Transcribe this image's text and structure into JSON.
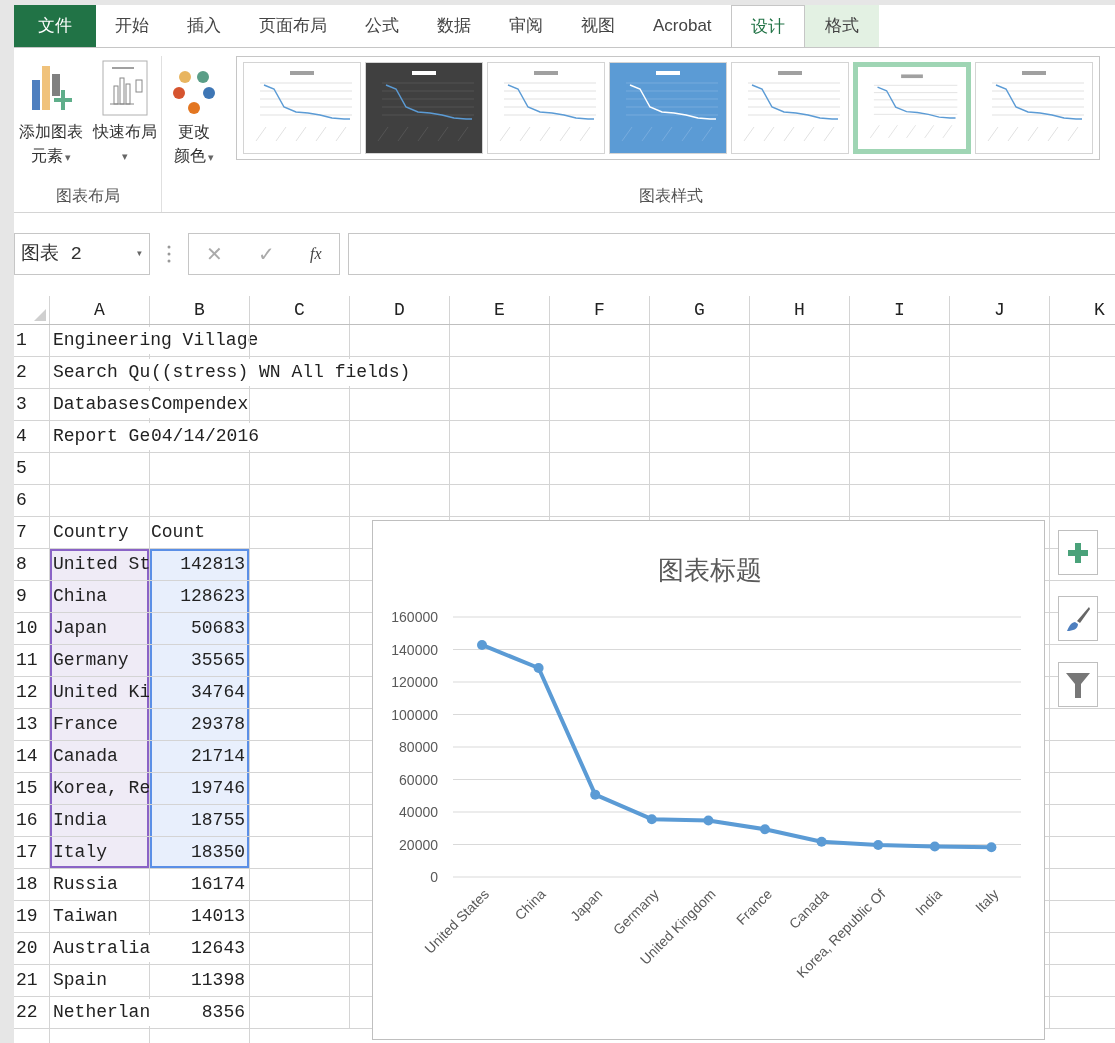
{
  "ribbon": {
    "tabs": [
      {
        "label": "文件",
        "kind": "file",
        "selected": false
      },
      {
        "label": "开始",
        "kind": "normal",
        "selected": false
      },
      {
        "label": "插入",
        "kind": "normal",
        "selected": false
      },
      {
        "label": "页面布局",
        "kind": "normal",
        "selected": false
      },
      {
        "label": "公式",
        "kind": "normal",
        "selected": false
      },
      {
        "label": "数据",
        "kind": "normal",
        "selected": false
      },
      {
        "label": "审阅",
        "kind": "normal",
        "selected": false
      },
      {
        "label": "视图",
        "kind": "normal",
        "selected": false
      },
      {
        "label": "Acrobat",
        "kind": "normal",
        "selected": false
      },
      {
        "label": "设计",
        "kind": "contextual",
        "selected": true
      },
      {
        "label": "格式",
        "kind": "contextual",
        "selected": false
      }
    ],
    "layout_group": {
      "label": "图表布局",
      "buttons": [
        {
          "kind": "add-element",
          "lines": [
            "添加图表",
            "元素"
          ],
          "caret": "▾"
        },
        {
          "kind": "quick-layout",
          "lines": [
            "快速布局"
          ],
          "caret": "▾"
        }
      ]
    },
    "color_button": {
      "lines": [
        "更改",
        "颜色"
      ],
      "caret": "▾"
    },
    "styles_group": {
      "label": "图表样式",
      "styles": [
        {
          "kind": "light",
          "selected": false
        },
        {
          "kind": "dark",
          "selected": false
        },
        {
          "kind": "light",
          "selected": false
        },
        {
          "kind": "blue",
          "selected": false
        },
        {
          "kind": "light",
          "selected": false
        },
        {
          "kind": "light",
          "selected": true
        },
        {
          "kind": "light",
          "selected": false
        }
      ]
    }
  },
  "formula_bar": {
    "name_box": "图表 2",
    "dropdown": "▾",
    "cancel": "✕",
    "enter": "✓",
    "function": "fx"
  },
  "sheet": {
    "columns": [
      "A",
      "B",
      "C",
      "D",
      "E",
      "F",
      "G",
      "H",
      "I",
      "J",
      "K"
    ],
    "rows": [
      {
        "number": "1",
        "kind": "info",
        "a": "Engineering Village",
        "in_chart": false
      },
      {
        "number": "2",
        "kind": "info",
        "a": "Search Qu",
        "b": "((stress) WN All fields)",
        "in_chart": false
      },
      {
        "number": "3",
        "kind": "info",
        "a": "Databases",
        "b": "Compendex",
        "in_chart": false
      },
      {
        "number": "4",
        "kind": "info",
        "a": "Report Ge",
        "b": "04/14/2016",
        "in_chart": false
      },
      {
        "number": "5",
        "kind": "info",
        "in_chart": false
      },
      {
        "number": "6",
        "kind": "info",
        "in_chart": false
      },
      {
        "number": "7",
        "kind": "info",
        "a": "Country",
        "b": "Count",
        "in_chart": false
      },
      {
        "number": "8",
        "kind": "data",
        "a": "United St",
        "b": "142813",
        "in_chart": true
      },
      {
        "number": "9",
        "kind": "data",
        "a": "China",
        "b": "128623",
        "in_chart": true
      },
      {
        "number": "10",
        "kind": "data",
        "a": "Japan",
        "b": "50683",
        "in_chart": true
      },
      {
        "number": "11",
        "kind": "data",
        "a": "Germany",
        "b": "35565",
        "in_chart": true
      },
      {
        "number": "12",
        "kind": "data",
        "a": "United Ki",
        "b": "34764",
        "in_chart": true
      },
      {
        "number": "13",
        "kind": "data",
        "a": "France",
        "b": "29378",
        "in_chart": true
      },
      {
        "number": "14",
        "kind": "data",
        "a": "Canada",
        "b": "21714",
        "in_chart": true
      },
      {
        "number": "15",
        "kind": "data",
        "a": "Korea, Re",
        "b": "19746",
        "in_chart": true
      },
      {
        "number": "16",
        "kind": "data",
        "a": "India",
        "b": "18755",
        "in_chart": true
      },
      {
        "number": "17",
        "kind": "data",
        "a": "Italy",
        "b": "18350",
        "in_chart": true
      },
      {
        "number": "18",
        "kind": "data",
        "a": "Russia",
        "b": "16174",
        "in_chart": false
      },
      {
        "number": "19",
        "kind": "data",
        "a": "Taiwan",
        "b": "14013",
        "in_chart": false
      },
      {
        "number": "20",
        "kind": "data",
        "a": "Australia",
        "b": "12643",
        "in_chart": false
      },
      {
        "number": "21",
        "kind": "data",
        "a": "Spain",
        "b": "11398",
        "in_chart": false
      },
      {
        "number": "22",
        "kind": "data",
        "a": "Netherlan",
        "b": "8356",
        "in_chart": false
      }
    ]
  },
  "chart": {
    "chart_data": {
      "type": "line",
      "title": "图表标题",
      "categories": [
        "United States",
        "China",
        "Japan",
        "Germany",
        "United Kingdom",
        "France",
        "Canada",
        "Korea, Republic Of",
        "India",
        "Italy"
      ],
      "grid": true,
      "series": [
        {
          "color": "#5b9bd5",
          "marker": true,
          "values": [
            142813,
            128623,
            50683,
            35565,
            34764,
            29378,
            21714,
            19746,
            18755,
            18350
          ]
        }
      ],
      "ylim": [
        0,
        160000
      ],
      "yticks": [
        0,
        20000,
        40000,
        60000,
        80000,
        100000,
        120000,
        140000,
        160000
      ]
    },
    "side_buttons": [
      {
        "kind": "elements"
      },
      {
        "kind": "styles"
      },
      {
        "kind": "filter"
      }
    ]
  }
}
